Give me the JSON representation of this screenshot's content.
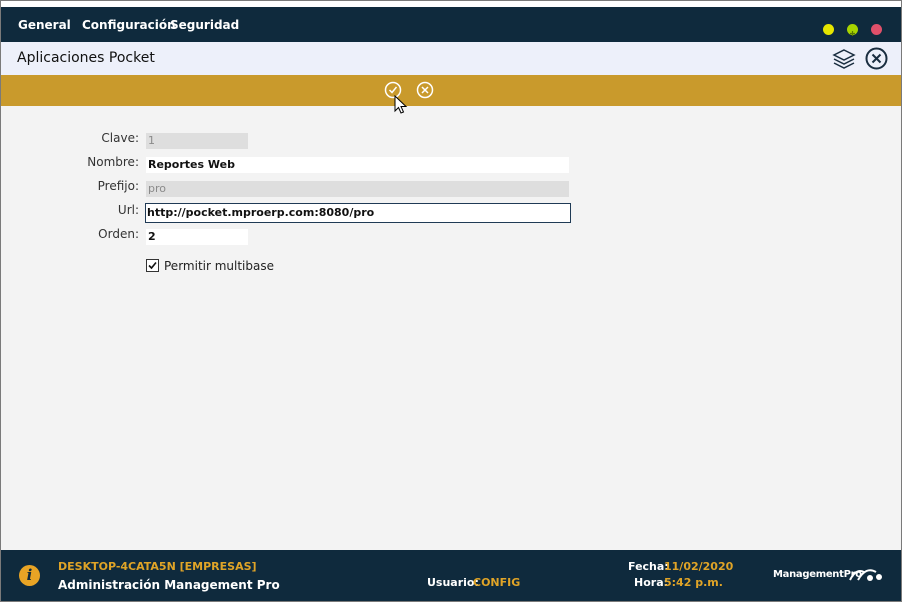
{
  "menu": {
    "items": [
      "General",
      "Configuración",
      "Seguridad"
    ]
  },
  "window_controls": {
    "minimize_color": "#e6e600",
    "maximize_color": "#a8d400",
    "close_color": "#e0506a"
  },
  "title": "Aplicaciones Pocket",
  "toolbar": {
    "accept_icon": "check-circle-icon",
    "cancel_icon": "x-circle-icon"
  },
  "form": {
    "clave": {
      "label": "Clave:",
      "value": "1"
    },
    "nombre": {
      "label": "Nombre:",
      "value": "Reportes Web"
    },
    "prefijo": {
      "label": "Prefijo:",
      "value": "pro"
    },
    "url": {
      "label": "Url:",
      "value": "http://pocket.mproerp.com:8080/pro"
    },
    "orden": {
      "label": "Orden:",
      "value": "2"
    },
    "multibase": {
      "label": "Permitir multibase",
      "checked": true
    }
  },
  "footer": {
    "machine": "DESKTOP-4CATA5N [EMPRESAS]",
    "app_name": "Administración Management Pro",
    "usuario_label": "Usuario:",
    "usuario_value": "CONFIG",
    "fecha_label": "Fecha:",
    "fecha_value": "11/02/2020",
    "hora_label": "Hora:",
    "hora_value": "5:42 p.m.",
    "brand": "ManagementPro"
  },
  "colors": {
    "topbar": "#0f2a3d",
    "toolbar": "#c99a2c",
    "accent": "#e0a427"
  }
}
